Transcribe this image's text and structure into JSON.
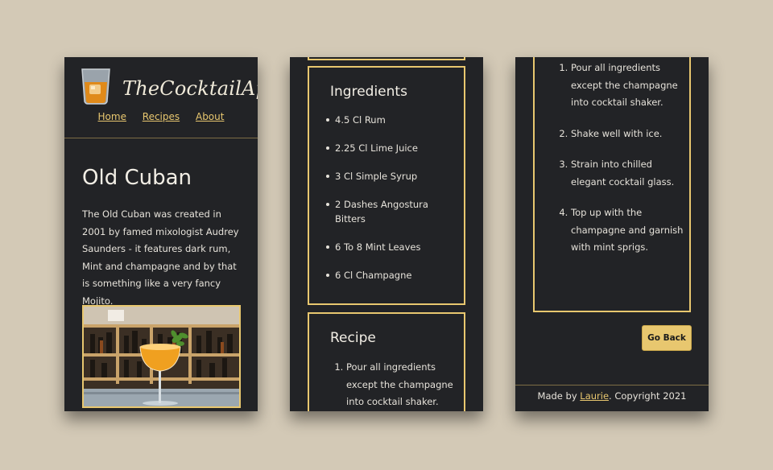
{
  "brand": {
    "name": "TheCocktailApp"
  },
  "nav": {
    "home": "Home",
    "recipes": "Recipes",
    "about": "About"
  },
  "cocktail": {
    "name": "Old Cuban",
    "description": "The Old Cuban was created in 2001 by famed mixologist Audrey Saunders - it features dark rum, Mint and champagne and by that is something like a very fancy Mojito."
  },
  "ingredients": {
    "heading": "Ingredients",
    "items": [
      "4.5 Cl Rum",
      "2.25 Cl Lime Juice",
      "3 Cl Simple Syrup",
      "2 Dashes Angostura Bitters",
      "6 To 8 Mint Leaves",
      "6 Cl Champagne"
    ]
  },
  "recipe": {
    "heading": "Recipe",
    "steps": [
      "Pour all ingredients except the champagne into cocktail shaker.",
      "Shake well with ice.",
      "Strain into chilled elegant cocktail glass.",
      "Top up with the champagne and garnish with mint sprigs."
    ]
  },
  "actions": {
    "go_back": "Go Back"
  },
  "footer": {
    "prefix": "Made by ",
    "author": "Laurie",
    "suffix": ". Copyright 2021"
  },
  "colors": {
    "background": "#d3c9b6",
    "panel": "#222326",
    "accent": "#e8c76f"
  }
}
